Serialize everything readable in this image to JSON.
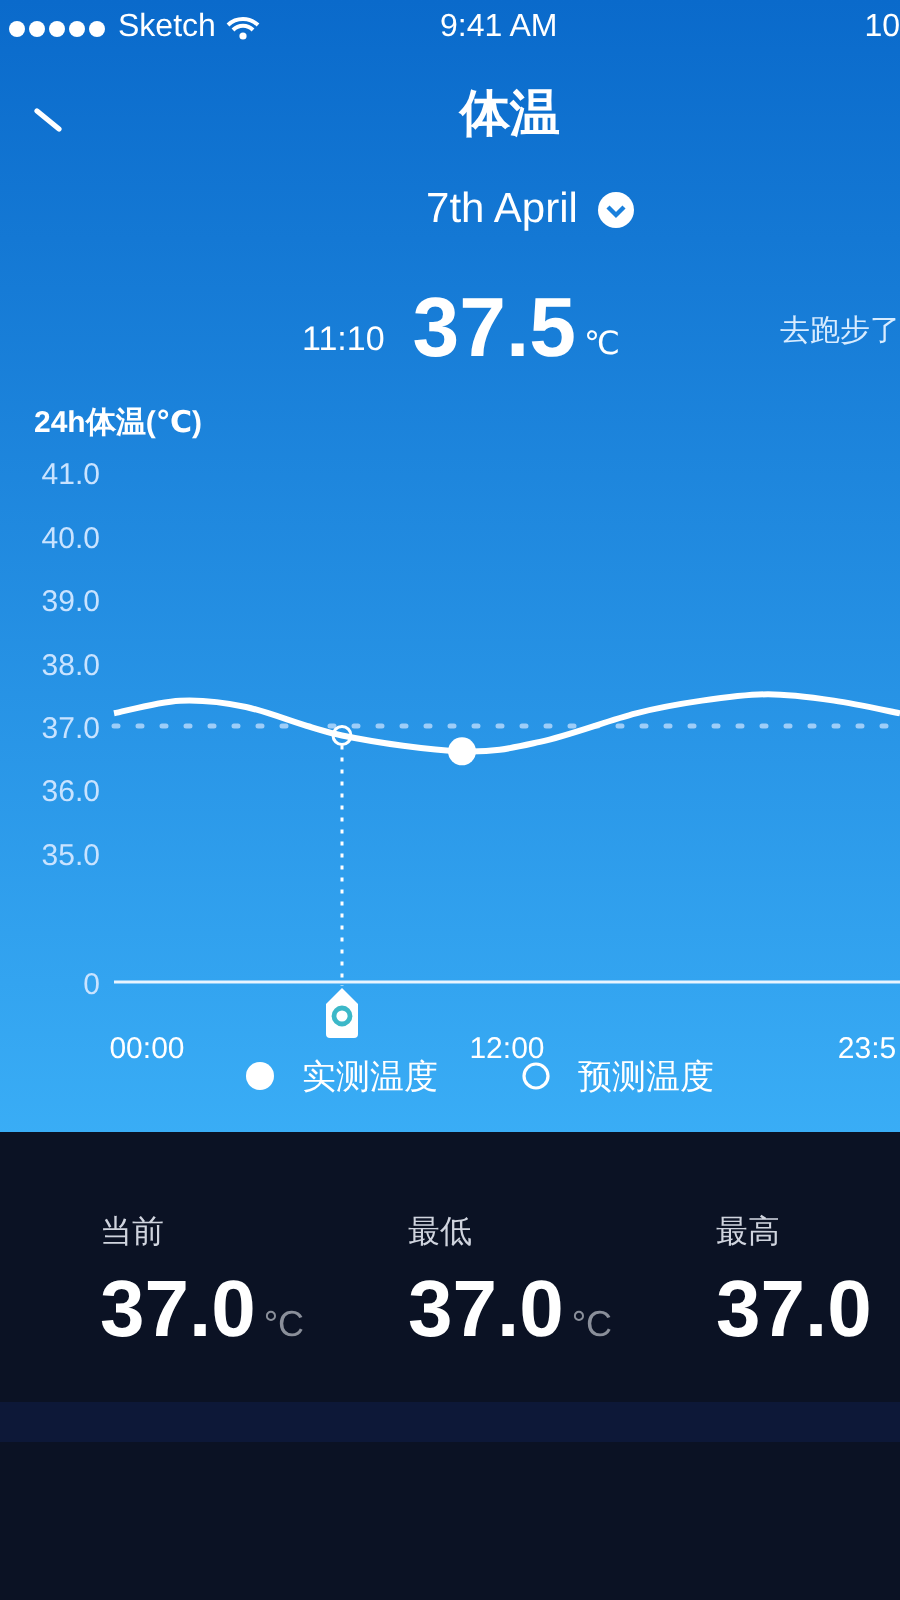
{
  "status_bar": {
    "carrier": "Sketch",
    "time": "9:41 AM",
    "battery": "10"
  },
  "header": {
    "title": "体温"
  },
  "date": {
    "label": "7th April"
  },
  "reading": {
    "time": "11:10",
    "value": "37.5",
    "unit": "℃",
    "note": "去跑步了"
  },
  "chart": {
    "title": "24h体温(℃)",
    "baseline_label": "0",
    "chart_data": {
      "type": "line",
      "x": [
        -1.1,
        1.1,
        3.3,
        6.5,
        10.5,
        13.1,
        16.3,
        18.5,
        20.7,
        22.9,
        25.1
      ],
      "series": [
        {
          "name": "实测温度",
          "color": "#ffffff",
          "values": [
            37.2,
            37.4,
            37.3,
            36.85,
            36.6,
            36.75,
            37.2,
            37.4,
            37.5,
            37.4,
            37.2
          ]
        },
        {
          "name": "预测温度",
          "color": "#ffffff",
          "marker": "circle",
          "values": [
            null,
            null,
            null,
            36.85,
            null,
            null,
            null,
            null,
            null,
            null,
            null
          ]
        }
      ],
      "xticks": [
        {
          "value": 0,
          "label": "00:00"
        },
        {
          "value": 12,
          "label": "12:00"
        },
        {
          "value": 24,
          "label": "23:5"
        }
      ],
      "xlim": [
        -1.1,
        25.1
      ],
      "ylim": [
        35,
        41
      ],
      "yticks": [
        {
          "value": 35,
          "label": "35.0"
        },
        {
          "value": 36,
          "label": "36.0"
        },
        {
          "value": 37,
          "label": "37.0"
        },
        {
          "value": 38,
          "label": "38.0"
        },
        {
          "value": 39,
          "label": "39.0"
        },
        {
          "value": 40,
          "label": "40.0"
        },
        {
          "value": 41,
          "label": "41.0"
        }
      ],
      "ref_lines": [
        {
          "value": 37.0,
          "axis": "y"
        },
        {
          "value": 6.5,
          "axis": "x"
        }
      ]
    }
  },
  "stats": [
    {
      "label": "当前",
      "value": "37.0",
      "unit": "°C"
    },
    {
      "label": "最低",
      "value": "37.0",
      "unit": "°C"
    },
    {
      "label": "最高",
      "value": "37.0"
    }
  ]
}
